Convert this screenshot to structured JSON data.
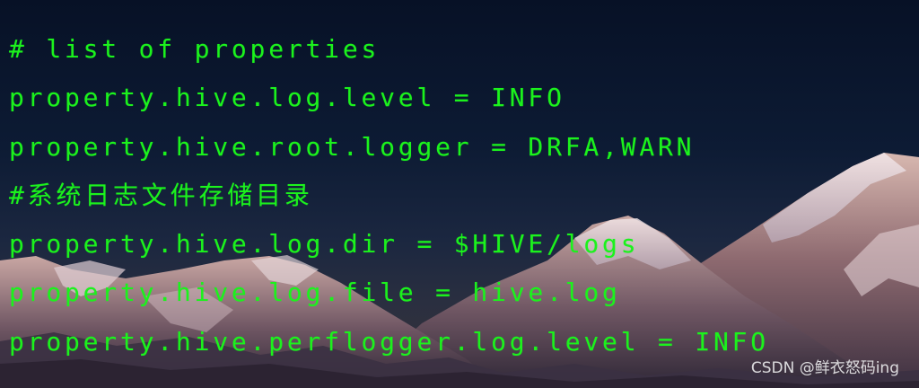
{
  "code_lines": [
    "# list of properties",
    "property.hive.log.level = INFO",
    "property.hive.root.logger = DRFA,WARN",
    "#系统日志文件存储目录",
    "property.hive.log.dir = $HIVE/logs",
    "property.hive.log.file = hive.log",
    "property.hive.perflogger.log.level = INFO"
  ],
  "watermark": "CSDN @鲜衣怒码ing",
  "colors": {
    "code_text": "#1cf21c",
    "background_top": "#071126",
    "background_bottom": "#3a3238"
  }
}
